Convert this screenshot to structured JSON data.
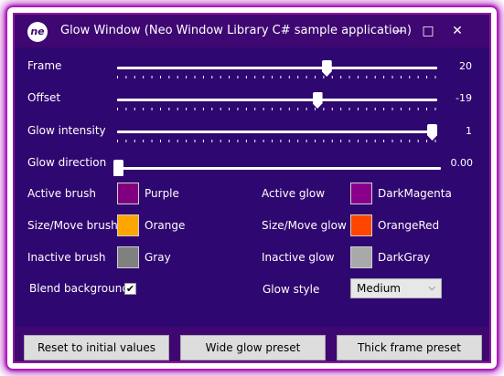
{
  "window": {
    "logo": "ne",
    "title": "Glow Window (Neo Window Library C# sample application)",
    "controls": {
      "minimize": "—",
      "maximize": "□",
      "close": "✕"
    }
  },
  "sliders": {
    "frame": {
      "label": "Frame",
      "value_text": "20",
      "fraction": 0.66
    },
    "offset": {
      "label": "Offset",
      "value_text": "-19",
      "fraction": 0.63
    },
    "glow_intensity": {
      "label": "Glow intensity",
      "value_text": "1",
      "fraction": 1.0
    },
    "glow_direction": {
      "label": "Glow direction",
      "value_text": "0.00",
      "fraction": 0.0
    }
  },
  "brushes": {
    "active_brush": {
      "label": "Active brush",
      "color_name": "Purple",
      "color": "#800080"
    },
    "active_glow": {
      "label": "Active glow",
      "color_name": "DarkMagenta",
      "color": "#8b008b"
    },
    "sizemove_brush": {
      "label": "Size/Move brush",
      "color_name": "Orange",
      "color": "#ffa500"
    },
    "sizemove_glow": {
      "label": "Size/Move glow",
      "color_name": "OrangeRed",
      "color": "#ff4500"
    },
    "inactive_brush": {
      "label": "Inactive brush",
      "color_name": "Gray",
      "color": "#808080"
    },
    "inactive_glow": {
      "label": "Inactive glow",
      "color_name": "DarkGray",
      "color": "#a9a9a9"
    }
  },
  "blend_background": {
    "label": "Blend background",
    "checked": true,
    "check_glyph": "✔"
  },
  "glow_style": {
    "label": "Glow style",
    "selected": "Medium",
    "arrow": "⌵"
  },
  "buttons": {
    "reset": "Reset to initial values",
    "wide_glow": "Wide glow preset",
    "thick_frame": "Thick frame preset"
  },
  "colors": {
    "window_bg": "#2f0770",
    "titlebar_bg": "#3e0772",
    "glow": "#a000b4"
  }
}
